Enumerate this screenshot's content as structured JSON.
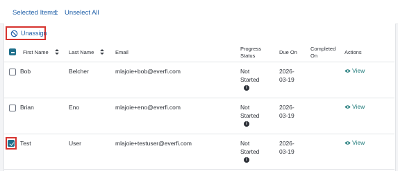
{
  "topbar": {
    "selected_label": "Selected Items:",
    "selected_count": "1",
    "unselect_all": "Unselect All"
  },
  "toolbar": {
    "unassign_label": "Unassign",
    "unassign_icon": "ban-icon"
  },
  "table": {
    "headers": {
      "first_name": "First Name",
      "last_name": "Last Name",
      "email": "Email",
      "progress_line1": "Progress",
      "progress_line2": "Status",
      "due_on": "Due On",
      "completed_line1": "Completed",
      "completed_line2": "On",
      "actions": "Actions"
    },
    "rows": [
      {
        "first": "Bob",
        "last": "Belcher",
        "email": "mlajoie+bob@everfi.com",
        "status1": "Not",
        "status2": "Started",
        "due1": "2026-",
        "due2": "03-19",
        "completed": "",
        "action": "View",
        "checked": false
      },
      {
        "first": "Brian",
        "last": "Eno",
        "email": "mlajoie+eno@everfi.com",
        "status1": "Not",
        "status2": "Started",
        "due1": "2026-",
        "due2": "03-19",
        "completed": "",
        "action": "View",
        "checked": false
      },
      {
        "first": "Test",
        "last": "User",
        "email": "mlajoie+testuser@everfi.com",
        "status1": "Not",
        "status2": "Started",
        "due1": "2026-",
        "due2": "03-19",
        "completed": "",
        "action": "View",
        "checked": true
      }
    ]
  },
  "colors": {
    "link": "#1f5fa8",
    "view": "#1f7a7a",
    "highlight": "#d6322e",
    "checkbox": "#1f6f8b"
  }
}
